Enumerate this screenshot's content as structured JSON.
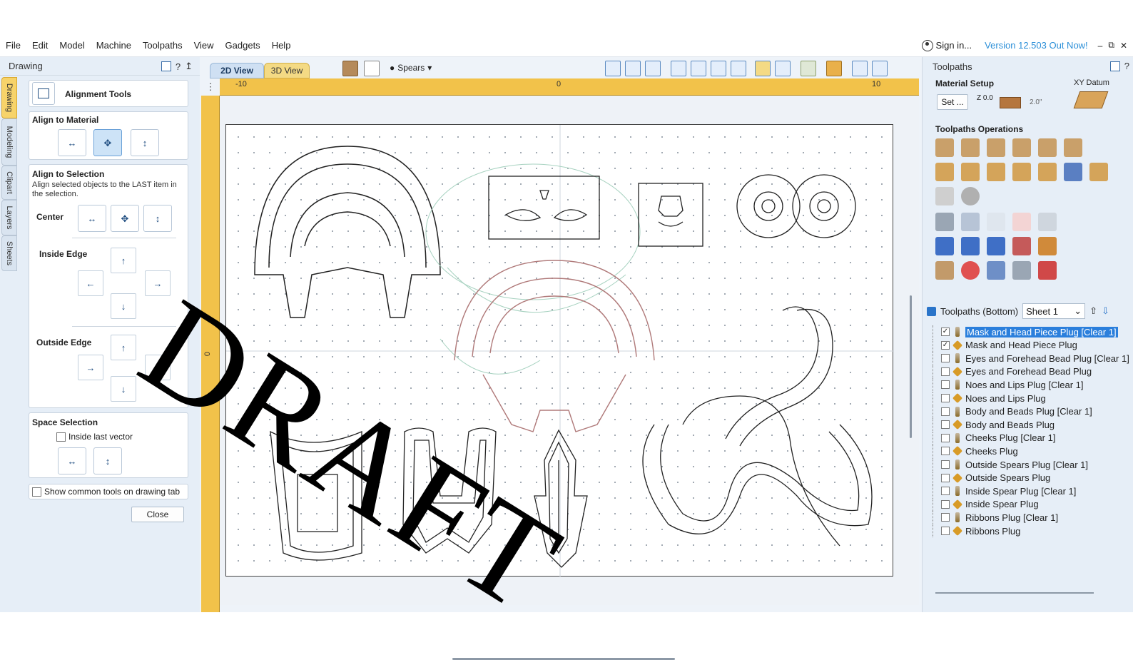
{
  "menu": [
    "File",
    "Edit",
    "Model",
    "Machine",
    "Toolpaths",
    "View",
    "Gadgets",
    "Help"
  ],
  "account": {
    "signin": "Sign in...",
    "version": "Version 12.503 Out Now!"
  },
  "left_panel": {
    "title": "Drawing",
    "vertical_tabs": [
      "Drawing",
      "Modeling",
      "Clipart",
      "Layers",
      "Sheets"
    ],
    "tool_title": "Alignment Tools",
    "align_material": "Align to Material",
    "align_selection": "Align to Selection",
    "align_selection_desc": "Align selected objects to the LAST item in the selection.",
    "center_label": "Center",
    "inside_edge_label": "Inside Edge",
    "outside_edge_label": "Outside Edge",
    "space_selection": "Space Selection",
    "inside_last_vector": "Inside last vector",
    "show_common_tools": "Show common tools on drawing tab",
    "close": "Close"
  },
  "view": {
    "tab_2d": "2D View",
    "tab_3d": "3D View",
    "model_dropdown": "Spears",
    "ruler_labels": [
      "-10",
      "0",
      "10"
    ],
    "ruler_left_label": "0",
    "watermark": "DRAFT"
  },
  "right_panel": {
    "title": "Toolpaths",
    "material_setup": "Material Setup",
    "xy_datum": "XY Datum",
    "set_button": "Set ...",
    "z_label": "Z 0.0",
    "thickness": "2.0\"",
    "toolpath_operations": "Toolpaths Operations",
    "list_title": "Toolpaths (Bottom)",
    "sheet_value": "Sheet 1",
    "toolpaths": [
      {
        "name": "Mask and Head Piece Plug [Clear 1]",
        "type": "bit",
        "checked": true,
        "selected": true
      },
      {
        "name": "Mask and Head Piece Plug",
        "type": "gem",
        "checked": true,
        "selected": false
      },
      {
        "name": "Eyes and Forehead Bead Plug [Clear 1]",
        "type": "bit",
        "checked": false,
        "selected": false
      },
      {
        "name": "Eyes and Forehead Bead Plug",
        "type": "gem",
        "checked": false,
        "selected": false
      },
      {
        "name": "Noes and Lips Plug [Clear 1]",
        "type": "bit",
        "checked": false,
        "selected": false
      },
      {
        "name": "Noes and Lips Plug",
        "type": "gem",
        "checked": false,
        "selected": false
      },
      {
        "name": "Body and Beads Plug [Clear 1]",
        "type": "bit",
        "checked": false,
        "selected": false
      },
      {
        "name": "Body and Beads Plug",
        "type": "gem",
        "checked": false,
        "selected": false
      },
      {
        "name": "Cheeks Plug [Clear 1]",
        "type": "bit",
        "checked": false,
        "selected": false
      },
      {
        "name": "Cheeks Plug",
        "type": "gem",
        "checked": false,
        "selected": false
      },
      {
        "name": "Outside Spears Plug [Clear 1]",
        "type": "bit",
        "checked": false,
        "selected": false
      },
      {
        "name": "Outside Spears Plug",
        "type": "gem",
        "checked": false,
        "selected": false
      },
      {
        "name": "Inside Spear Plug [Clear 1]",
        "type": "bit",
        "checked": false,
        "selected": false
      },
      {
        "name": "Inside Spear Plug",
        "type": "gem",
        "checked": false,
        "selected": false
      },
      {
        "name": "Ribbons Plug [Clear 1]",
        "type": "bit",
        "checked": false,
        "selected": false
      },
      {
        "name": "Ribbons Plug",
        "type": "gem",
        "checked": false,
        "selected": false
      }
    ]
  },
  "colors": {
    "ruler": "#f2c24a",
    "accent": "#2b7fdc",
    "panel": "#e6eef7"
  }
}
